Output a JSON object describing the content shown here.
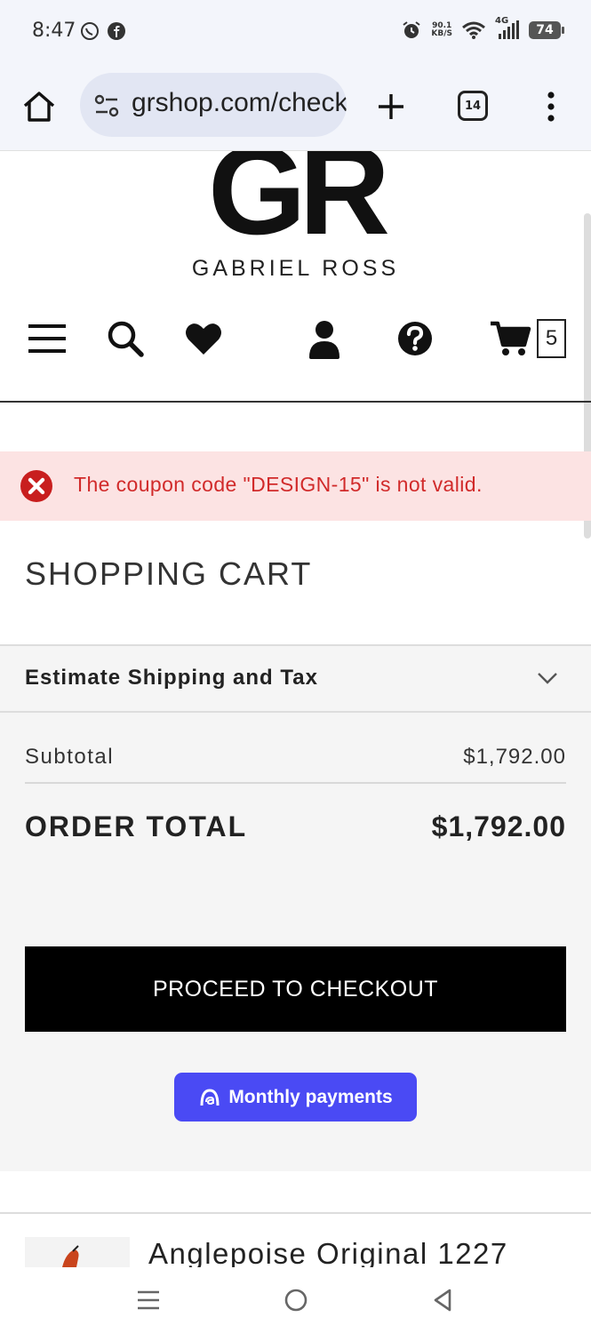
{
  "status_bar": {
    "time": "8:47",
    "net_speed_top": "90.1",
    "net_speed_bottom": "KB/S",
    "network": "4G",
    "battery": "74"
  },
  "browser": {
    "url": "grshop.com/checkout/cart",
    "tab_count": "14"
  },
  "logo": {
    "mark": "GR",
    "name": "GABRIEL ROSS"
  },
  "nav": {
    "cart_count": "5"
  },
  "error": {
    "message": "The coupon code \"DESIGN-15\" is not valid.",
    "color": "#d12a2a",
    "background": "#fce3e3"
  },
  "cart": {
    "title": "SHOPPING CART",
    "shipping_label": "Estimate Shipping and Tax",
    "subtotal_label": "Subtotal",
    "subtotal_value": "$1,792.00",
    "order_total_label": "ORDER TOTAL",
    "order_total_value": "$1,792.00",
    "checkout_label": "PROCEED TO CHECKOUT",
    "monthly_label": "Monthly payments",
    "monthly_color": "#4a4af4"
  },
  "item": {
    "title": "Anglepoise Original 1227"
  }
}
